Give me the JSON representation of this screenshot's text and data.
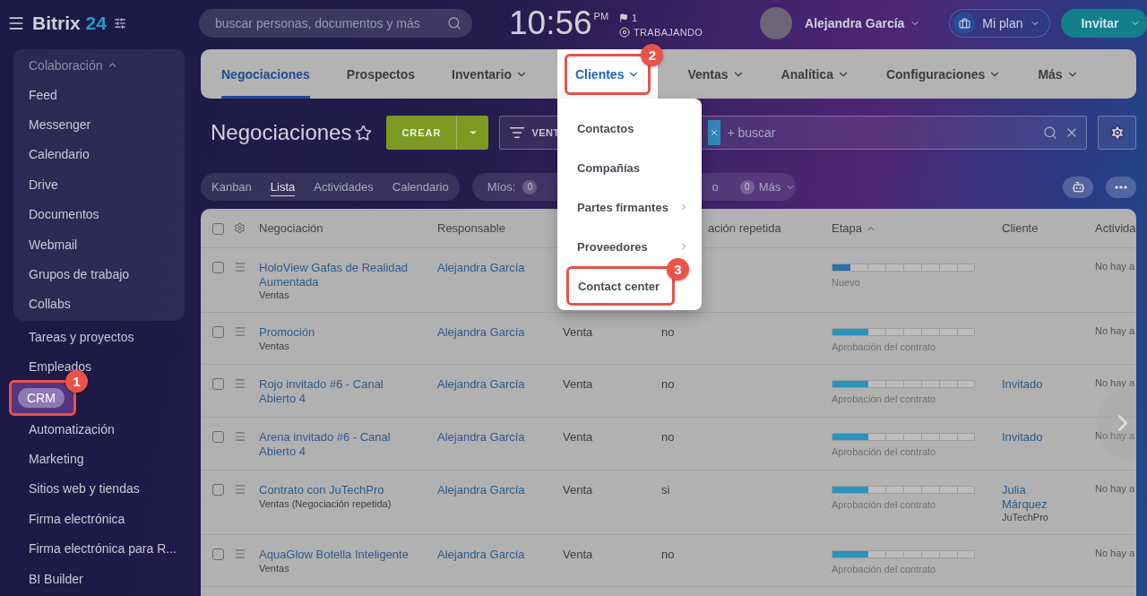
{
  "header": {
    "logo": {
      "name": "Bitrix",
      "number": "24"
    },
    "search": {
      "placeholder": "buscar personas, documentos y más"
    },
    "clock": {
      "time": "10:56",
      "period": "PM",
      "flag_count": "1",
      "status": "TRABAJANDO"
    },
    "user": {
      "name": "Alejandra García"
    },
    "plan_button": "Mi plan",
    "invite_button": "Invitar"
  },
  "sidebar": {
    "items": [
      {
        "kind": "group",
        "label": "Colaboración",
        "expanded": true,
        "children": [
          {
            "label": "Feed",
            "selected": false
          },
          {
            "label": "Messenger",
            "selected": false
          },
          {
            "label": "Calendario",
            "selected": false
          },
          {
            "label": "Drive",
            "selected": false
          },
          {
            "label": "Documentos",
            "selected": false
          },
          {
            "label": "Webmail",
            "selected": false
          },
          {
            "label": "Grupos de trabajo",
            "selected": false
          },
          {
            "label": "Collabs",
            "selected": false
          }
        ]
      },
      {
        "kind": "item",
        "label": "Tareas y proyectos",
        "selected": false
      },
      {
        "kind": "item",
        "label": "Empleados",
        "selected": false
      },
      {
        "kind": "item",
        "label": "CRM",
        "selected": true,
        "annotation": "1"
      },
      {
        "kind": "item",
        "label": "Automatización",
        "selected": false
      },
      {
        "kind": "item",
        "label": "Marketing",
        "selected": false
      },
      {
        "kind": "item",
        "label": "Sitios web y tiendas",
        "selected": false
      },
      {
        "kind": "item",
        "label": "Firma electrónica",
        "selected": false
      },
      {
        "kind": "item",
        "label": "Firma electrónica para R...",
        "selected": false
      },
      {
        "kind": "item",
        "label": "BI Builder",
        "selected": false
      }
    ]
  },
  "nav_tabs": [
    {
      "label": "Negociaciones",
      "selected": true,
      "dropdown": false,
      "open": false
    },
    {
      "label": "Prospectos",
      "selected": false,
      "dropdown": false,
      "open": false
    },
    {
      "label": "Inventario",
      "selected": false,
      "dropdown": true,
      "open": false
    },
    {
      "label": "Clientes",
      "selected": false,
      "dropdown": true,
      "open": true,
      "annotation": "2"
    },
    {
      "label": "Ventas",
      "selected": false,
      "dropdown": true,
      "open": false
    },
    {
      "label": "Analítica",
      "selected": false,
      "dropdown": true,
      "open": false
    },
    {
      "label": "Configuraciones",
      "selected": false,
      "dropdown": true,
      "open": false
    },
    {
      "label": "Más",
      "selected": false,
      "dropdown": true,
      "open": false
    }
  ],
  "dropdown_menu": {
    "items": [
      {
        "label": "Contactos",
        "submenu": false
      },
      {
        "label": "Compañías",
        "submenu": false
      },
      {
        "label": "Partes firmantes",
        "submenu": true
      },
      {
        "label": "Proveedores",
        "submenu": true
      },
      {
        "label": "Contact center",
        "submenu": false,
        "annotation": "3"
      }
    ]
  },
  "page": {
    "title": "Negociaciones",
    "create_button": "CREAR",
    "filter": {
      "preset": "VENT",
      "placeholder": "+ buscar"
    }
  },
  "view_tabs": [
    {
      "label": "Kanban",
      "selected": false
    },
    {
      "label": "Lista",
      "selected": true
    },
    {
      "label": "Actividades",
      "selected": false
    },
    {
      "label": "Calendario",
      "selected": false
    }
  ],
  "counters": [
    {
      "kind": "label",
      "text": "Míos:"
    },
    {
      "kind": "count",
      "text": "0"
    },
    {
      "kind": "fragment",
      "text": "o"
    },
    {
      "kind": "count",
      "text": "0"
    },
    {
      "kind": "dropdown",
      "text": "Más"
    }
  ],
  "table": {
    "all_checked": false,
    "headers": {
      "deal": "Negociación",
      "responsible": "Responsable",
      "column_4": "ación repetida",
      "stage": "Etapa",
      "client": "Cliente",
      "activity": "Activida"
    },
    "rows": [
      {
        "checked": false,
        "title": "HoloView Gafas de Realidad Aumentada",
        "subtitle": "Ventas",
        "responsible": "Alejandra García",
        "stage": {
          "label": "Nuevo",
          "level": 0.125,
          "color": "#2b6faf"
        },
        "activity": "No hay a"
      },
      {
        "checked": false,
        "title": "Promoción",
        "subtitle": "Ventas",
        "responsible": "Alejandra García",
        "column_3": "Venta",
        "column_4": "no",
        "stage": {
          "label": "Aprobación del contrato",
          "level": 0.25,
          "color": "#2a93bd"
        },
        "activity": "No hay a"
      },
      {
        "checked": false,
        "title": "Rojo invitado #6 - Canal Abierto 4",
        "responsible": "Alejandra García",
        "column_3": "Venta",
        "column_4": "no",
        "stage": {
          "label": "Aprobación del contrato",
          "level": 0.25,
          "color": "#2a93bd"
        },
        "client": "Invitado",
        "activity": "No hay a"
      },
      {
        "checked": false,
        "title": "Arena invitado #6 - Canal Abierto 4",
        "responsible": "Alejandra García",
        "column_3": "Venta",
        "column_4": "no",
        "stage": {
          "label": "Aprobación del contrato",
          "level": 0.25,
          "color": "#2a93bd"
        },
        "client": "Invitado",
        "activity": "No hay a"
      },
      {
        "checked": false,
        "title": "Contrato con JuTechPro",
        "subtitle": "Ventas (Negociación repetida)",
        "responsible": "Alejandra García",
        "column_3": "Venta",
        "column_4": "si",
        "stage": {
          "label": "Aprobación del contrato",
          "level": 0.25,
          "color": "#2a93bd"
        },
        "client": "Julia Márquez",
        "client_company": "JuTechPro",
        "activity": "No hay a"
      },
      {
        "checked": false,
        "title": "AquaGlow Botella Inteligente",
        "subtitle": "Ventas",
        "responsible": "Alejandra García",
        "column_3": "Venta",
        "column_4": "no",
        "stage": {
          "label": "Aprobación del contrato",
          "level": 0.25,
          "color": "#2a93bd"
        },
        "activity": "No hay a"
      }
    ]
  }
}
